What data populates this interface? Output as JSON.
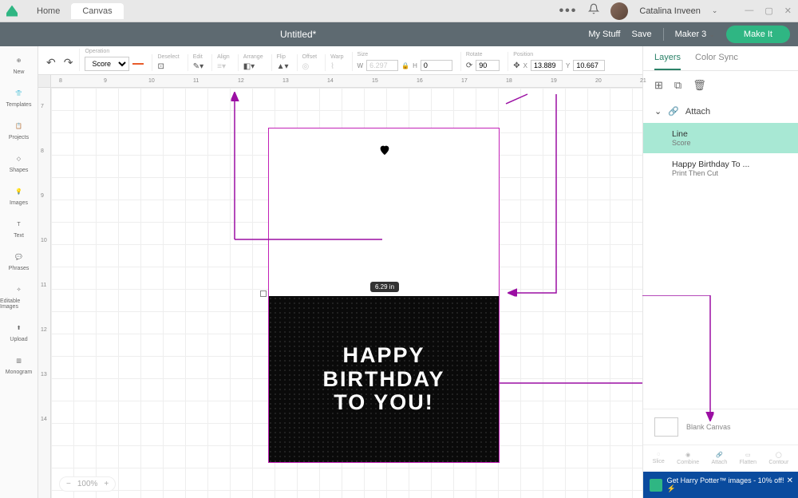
{
  "topbar": {
    "tabs": [
      "Home",
      "Canvas"
    ],
    "user": "Catalina Inveen"
  },
  "header": {
    "title": "Untitled*",
    "links": {
      "mystuff": "My Stuff",
      "save": "Save",
      "machine": "Maker 3"
    },
    "makeit": "Make It"
  },
  "leftnav": [
    {
      "label": "New"
    },
    {
      "label": "Templates"
    },
    {
      "label": "Projects"
    },
    {
      "label": "Shapes"
    },
    {
      "label": "Images"
    },
    {
      "label": "Text"
    },
    {
      "label": "Phrases"
    },
    {
      "label": "Editable Images"
    },
    {
      "label": "Upload"
    },
    {
      "label": "Monogram"
    }
  ],
  "toolbar": {
    "operation": {
      "lbl": "Operation",
      "val": "Score"
    },
    "deselect": "Deselect",
    "edit": "Edit",
    "align": "Align",
    "arrange": "Arrange",
    "flip": "Flip",
    "offset": "Offset",
    "warp": "Warp",
    "size": "Size",
    "rotate": "Rotate",
    "position": "Position",
    "size_w": "6.297",
    "size_h": "0",
    "rot": "90",
    "pos_x": "13.889",
    "pos_y": "10.667"
  },
  "ruler_h": [
    "8",
    "9",
    "10",
    "11",
    "12",
    "13",
    "14",
    "15",
    "16",
    "17",
    "18",
    "19",
    "20",
    "21"
  ],
  "ruler_v": [
    "7",
    "8",
    "9",
    "10",
    "11",
    "12",
    "13",
    "14"
  ],
  "canvas": {
    "sizelabel": "6.29 in",
    "card_line1": "HAPPY",
    "card_line2": "BIRTHDAY",
    "card_line3": "TO YOU!"
  },
  "layers": {
    "tab1": "Layers",
    "tab2": "Color Sync",
    "attach": "Attach",
    "l1": {
      "name": "Line",
      "sub": "Score"
    },
    "l2": {
      "name": "Happy Birthday To ...",
      "sub": "Print Then Cut"
    },
    "blank": "Blank Canvas",
    "ops": [
      "Slice",
      "Combine",
      "Attach",
      "Flatten",
      "Contour"
    ]
  },
  "zoom": "100%",
  "promo": "Get Harry Potter™ images - 10% off! ⚡"
}
